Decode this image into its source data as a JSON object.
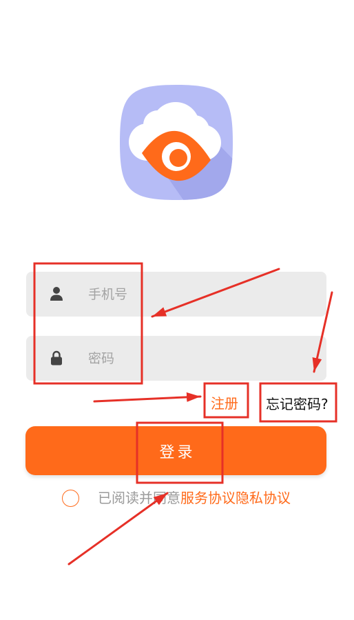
{
  "login_form": {
    "phone_placeholder": "手机号",
    "password_placeholder": "密码",
    "register_label": "注册",
    "forgot_password_label": "忘记密码?",
    "login_button_label": "登录"
  },
  "agreement": {
    "prefix": "已阅读并同意",
    "service_agreement": "服务协议",
    "privacy_agreement": "隐私协议",
    "checked": false
  },
  "icons": {
    "logo": "cloud-eye-logo-icon",
    "phone_field": "user-icon",
    "password_field": "lock-icon",
    "agreement_check": "radio-circle-icon"
  },
  "colors": {
    "accent": "#ff6a1a",
    "field_background": "#ebebeb",
    "placeholder": "#a3a3a3",
    "logo_background": "#b6bcf6",
    "logo_shadow": "#a2a8ec",
    "icon": "#444444",
    "link_text": "#111111",
    "agreement_text": "#9a9a9a",
    "annotation": "#e63027"
  }
}
